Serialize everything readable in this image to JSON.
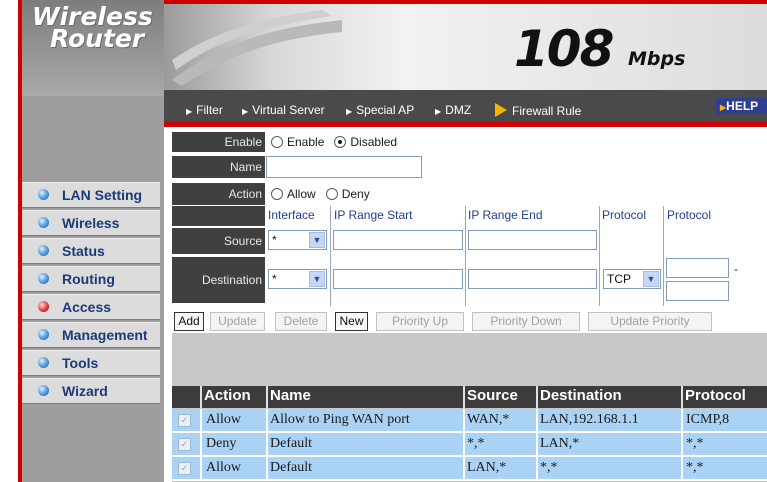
{
  "logo": {
    "line1": "Wireless",
    "line2": "Router"
  },
  "banner": {
    "speed": "108",
    "unit": "Mbps"
  },
  "nav": {
    "items": [
      "Filter",
      "Virtual Server",
      "Special AP",
      "DMZ",
      "Firewall Rule"
    ],
    "help": "HELP"
  },
  "sidebar": {
    "items": [
      {
        "label": "LAN Setting"
      },
      {
        "label": "Wireless"
      },
      {
        "label": "Status"
      },
      {
        "label": "Routing"
      },
      {
        "label": "Access",
        "active": true
      },
      {
        "label": "Management"
      },
      {
        "label": "Tools"
      },
      {
        "label": "Wizard"
      }
    ]
  },
  "form": {
    "enable_label": "Enable",
    "enable_option": "Enable",
    "disabled_option": "Disabled",
    "enable_selected": "Disabled",
    "name_label": "Name",
    "name_value": "",
    "action_label": "Action",
    "allow_option": "Allow",
    "deny_option": "Deny",
    "action_selected": "none",
    "col_interface": "Interface",
    "col_ip_start": "IP Range Start",
    "col_ip_end": "IP Range End",
    "col_protocol": "Protocol",
    "col_protocol2": "Protocol",
    "source_label": "Source",
    "source_interface": "*",
    "destination_label": "Destination",
    "destination_interface": "*",
    "destination_protocol": "TCP",
    "port_separator": "-"
  },
  "buttons": {
    "add": "Add",
    "update": "Update",
    "delete": "Delete",
    "new": "New",
    "priority_up": "Priority Up",
    "priority_down": "Priority Down",
    "update_priority": "Update Priority"
  },
  "rules": {
    "headers": [
      "Action",
      "Name",
      "Source",
      "Destination",
      "Protocol"
    ],
    "rows": [
      {
        "action": "Allow",
        "name": "Allow to Ping WAN port",
        "source": "WAN,*",
        "destination": "LAN,192.168.1.1",
        "protocol": "ICMP,8"
      },
      {
        "action": "Deny",
        "name": "Default",
        "source": "*,*",
        "destination": "LAN,*",
        "protocol": "*,*"
      },
      {
        "action": "Allow",
        "name": "Default",
        "source": "LAN,*",
        "destination": "*,*",
        "protocol": "*,*"
      }
    ]
  },
  "colors": {
    "accent_red": "#d00000",
    "row_blue": "#a9d2f5",
    "dark": "#404040"
  }
}
